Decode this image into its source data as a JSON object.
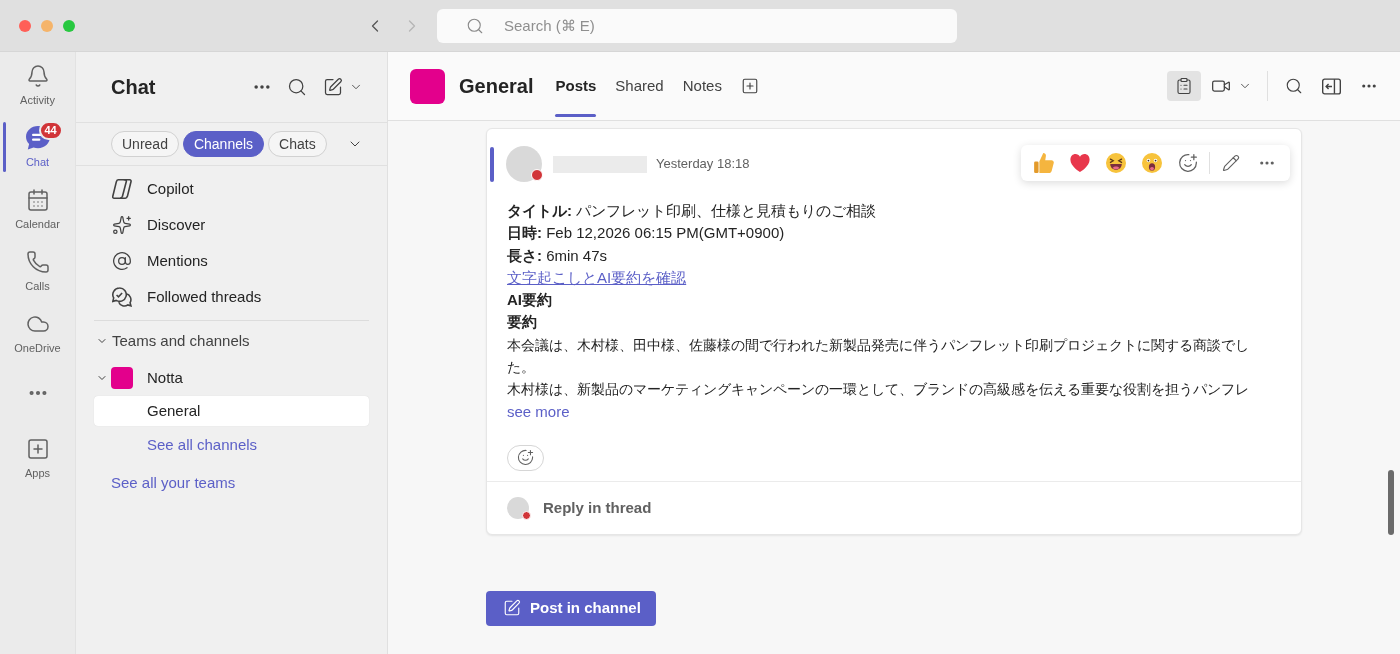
{
  "window": {
    "nav": {
      "back": {
        "disabled": false
      },
      "forward": {
        "disabled": true
      }
    },
    "search": {
      "placeholder": "Search (⌘ E)"
    }
  },
  "rail": {
    "items": [
      {
        "label": "Activity",
        "selected": false
      },
      {
        "label": "Chat",
        "selected": true,
        "badge": "44"
      },
      {
        "label": "Calendar",
        "selected": false
      },
      {
        "label": "Calls",
        "selected": false
      },
      {
        "label": "OneDrive",
        "selected": false
      }
    ],
    "apps": {
      "label": "Apps"
    }
  },
  "sidebar": {
    "title": "Chat",
    "filters": [
      {
        "label": "Unread",
        "selected": false
      },
      {
        "label": "Channels",
        "selected": true
      },
      {
        "label": "Chats",
        "selected": false
      }
    ],
    "items": [
      {
        "label": "Copilot",
        "selected": false
      },
      {
        "label": "Discover",
        "selected": false
      },
      {
        "label": "Mentions",
        "selected": false
      },
      {
        "label": "Followed threads",
        "selected": false
      }
    ],
    "teams_section": {
      "label": "Teams and channels",
      "expanded": true,
      "teams": [
        {
          "name": "Notta",
          "color": "#e3008c",
          "expanded": true,
          "channels": [
            {
              "name": "General",
              "selected": true
            }
          ],
          "see_all_channels": "See all channels"
        }
      ]
    },
    "see_all_teams": "See all your teams"
  },
  "channel": {
    "title": "General",
    "tabs": [
      {
        "label": "Posts",
        "selected": true
      },
      {
        "label": "Shared",
        "selected": false
      },
      {
        "label": "Notes",
        "selected": false
      }
    ]
  },
  "post": {
    "author": {
      "busy": true
    },
    "time": "Yesterday 18:18",
    "body": [
      {
        "kind": "field",
        "text": "**タイトル:** パンフレット印刷、仕様と見積もりのご相談"
      },
      {
        "kind": "field",
        "text": "**日時:** Feb 12,2026 06:15 PM(GMT+0900)"
      },
      {
        "kind": "field",
        "text": "**長さ:** 6min 47s"
      },
      {
        "kind": "link",
        "text": "文字起こしとAI要約を確認"
      },
      {
        "kind": "heading",
        "text": "AI要約"
      },
      {
        "kind": "heading",
        "text": "要約"
      },
      {
        "kind": "paragraph",
        "text": "本会議は、木村様、田中様、佐藤様の間で行われた新製品発売に伴うパンフレット印刷プロジェクトに関する商談でした。"
      },
      {
        "kind": "paragraph",
        "text": "木村様は、新製品のマーケティングキャンペーンの一環として、ブランドの高級感を伝える重要な役割を担うパンフレ"
      }
    ],
    "see_more": "see more",
    "reply": {
      "label": "Reply in thread",
      "busy": true
    }
  },
  "post_button": {
    "label": "Post in channel"
  }
}
